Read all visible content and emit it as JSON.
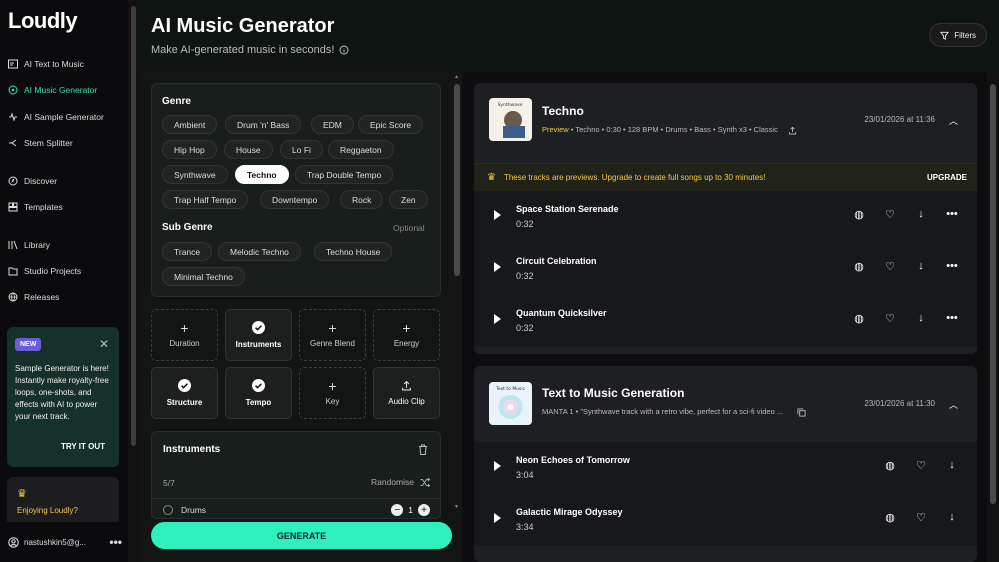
{
  "sidebar": {
    "logo": "Loudly",
    "items": [
      {
        "label": "AI Text to Music",
        "icon": "text-music-icon"
      },
      {
        "label": "AI Music Generator",
        "icon": "music-generator-icon",
        "active": true
      },
      {
        "label": "AI Sample Generator",
        "icon": "sample-icon"
      },
      {
        "label": "Stem Splitter",
        "icon": "split-icon"
      },
      {
        "label": "Discover",
        "icon": "compass-icon"
      },
      {
        "label": "Templates",
        "icon": "templates-icon"
      },
      {
        "label": "Library",
        "icon": "library-icon"
      },
      {
        "label": "Studio Projects",
        "icon": "folder-icon"
      },
      {
        "label": "Releases",
        "icon": "globe-icon"
      }
    ],
    "promo": {
      "badge": "NEW",
      "text": "Sample Generator is here! Instantly make royalty-free loops, one-shots, and effects with AI to power your next track.",
      "cta": "TRY IT OUT"
    },
    "enjoy_text": "Enjoying Loudly?",
    "user": "nastushkin5@g..."
  },
  "header": {
    "title": "AI Music Generator",
    "subtitle": "Make AI-generated music in seconds!",
    "filters_label": "Filters"
  },
  "genre": {
    "title": "Genre",
    "chips": [
      "Ambient",
      "Drum 'n' Bass",
      "EDM",
      "Epic Score",
      "Hip Hop",
      "House",
      "Lo Fi",
      "Reggaeton",
      "Synthwave",
      "Techno",
      "Trap Double Tempo",
      "Trap Half Tempo",
      "Downtempo",
      "Rock",
      "Zen"
    ],
    "selected": "Techno"
  },
  "subgenre": {
    "title": "Sub Genre",
    "optional": "Optional",
    "chips": [
      "Trance",
      "Melodic Techno",
      "Techno House",
      "Minimal Techno"
    ]
  },
  "options": [
    {
      "label": "Duration",
      "state": "add"
    },
    {
      "label": "Instruments",
      "state": "set"
    },
    {
      "label": "Genre Blend",
      "state": "add"
    },
    {
      "label": "Energy",
      "state": "add"
    },
    {
      "label": "Structure",
      "state": "set"
    },
    {
      "label": "Tempo",
      "state": "set"
    },
    {
      "label": "Key",
      "state": "add"
    },
    {
      "label": "Audio Clip",
      "state": "upload"
    }
  ],
  "instruments": {
    "title": "Instruments",
    "count": "5/7",
    "randomise": "Randomise",
    "first_item": "Drums",
    "first_count": "1"
  },
  "generate_label": "GENERATE",
  "cards": [
    {
      "title": "Techno",
      "cover_text": "Synthwave",
      "preview": "Preview",
      "meta": " • Techno • 0:30 • 128 BPM • Drums • Bass • Synth x3 • Classic",
      "date": "23/01/2026 at 11:36",
      "banner": "These tracks are previews. Upgrade to create full songs up to 30 minutes!",
      "upgrade": "UPGRADE",
      "tracks": [
        {
          "name": "Space Station Serenade",
          "duration": "0:32"
        },
        {
          "name": "Circuit Celebration",
          "duration": "0:32"
        },
        {
          "name": "Quantum Quicksilver",
          "duration": "0:32"
        }
      ]
    },
    {
      "title": "Text to Music Generation",
      "cover_text": "Text to Music",
      "meta": "MANTA 1 • \"Synthwave track with a retro vibe, perfect for a sci-fi video ...",
      "date": "23/01/2026 at 11:30",
      "tracks": [
        {
          "name": "Neon Echoes of Tomorrow",
          "duration": "3:04"
        },
        {
          "name": "Galactic Mirage Odyssey",
          "duration": "3:34"
        }
      ]
    }
  ],
  "colors": {
    "accent": "#2fe0b4",
    "generate": "#2ef0bc",
    "preview": "#f2c94c",
    "badge": "#6c5bd6"
  }
}
